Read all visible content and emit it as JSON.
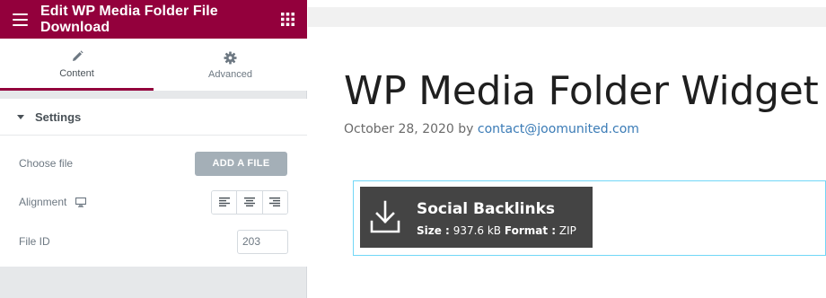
{
  "sidebar": {
    "topbar": {
      "title": "Edit WP Media Folder File Download"
    },
    "tabs": [
      {
        "label": "Content",
        "icon": "pencil-icon",
        "active": true
      },
      {
        "label": "Advanced",
        "icon": "gear-icon",
        "active": false
      }
    ],
    "section": {
      "title": "Settings"
    },
    "controls": {
      "choose_file": {
        "label": "Choose file",
        "button_label": "ADD A FILE"
      },
      "alignment": {
        "label": "Alignment",
        "options": [
          "left",
          "center",
          "right"
        ]
      },
      "file_id": {
        "label": "File ID",
        "value": "203"
      }
    }
  },
  "preview": {
    "page_title": "WP Media Folder Widget",
    "meta": {
      "date_by": "October 28, 2020 by ",
      "author": "contact@joomunited.com"
    },
    "download": {
      "name": "Social Backlinks",
      "size_label": "Size :",
      "size_value": "937.6 kB",
      "format_label": "Format :",
      "format_value": "ZIP"
    }
  },
  "colors": {
    "brand": "#93003c",
    "button": "#a4afb7",
    "card": "#444444",
    "link": "#3a7bb6",
    "frame": "#71d7f7"
  }
}
